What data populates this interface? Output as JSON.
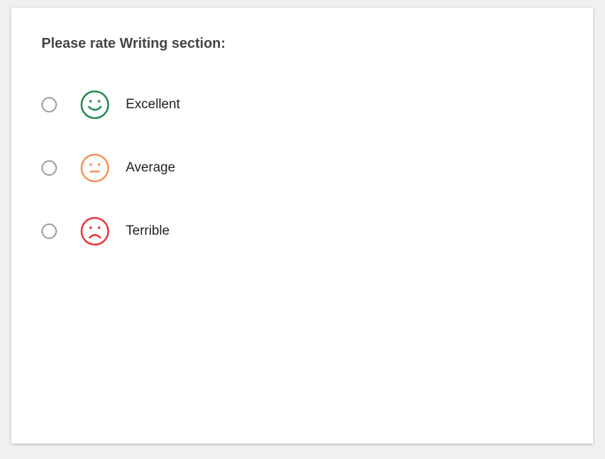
{
  "question": {
    "title": "Please rate Writing section:"
  },
  "options": [
    {
      "label": "Excellent",
      "icon": "happy-face-icon",
      "color": "#1e8a4a",
      "selected": false
    },
    {
      "label": "Average",
      "icon": "neutral-face-icon",
      "color": "#f5914f",
      "selected": false
    },
    {
      "label": "Terrible",
      "icon": "sad-face-icon",
      "color": "#e8343b",
      "selected": false
    }
  ]
}
